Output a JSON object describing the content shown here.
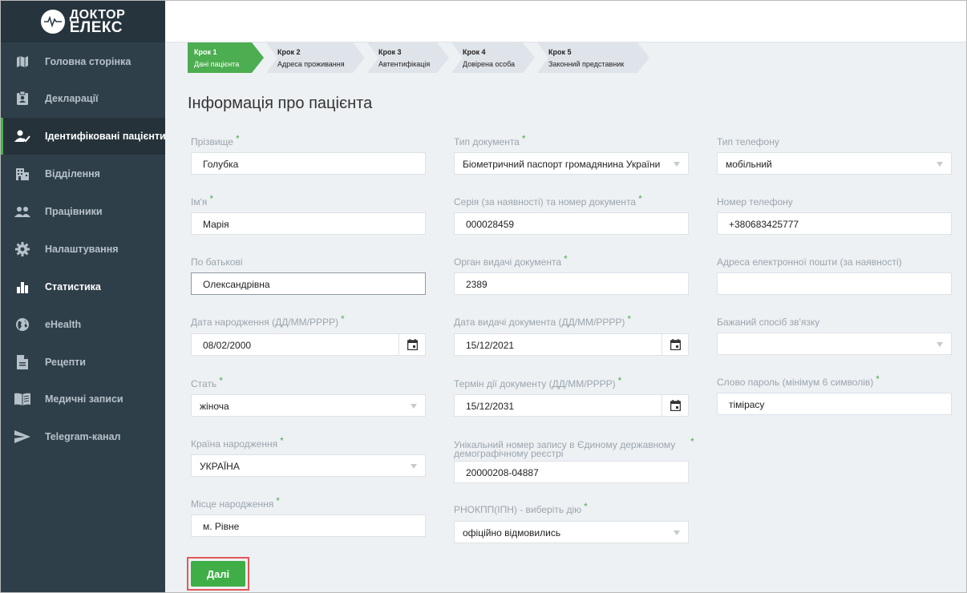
{
  "brand": {
    "line1": "ДОКТОР",
    "line2": "ЕЛЕКС"
  },
  "sidebar": {
    "items": [
      {
        "label": "Головна сторінка",
        "icon": "map-icon"
      },
      {
        "label": "Декларації",
        "icon": "badge-icon"
      },
      {
        "label": "Ідентифіковані пацієнти",
        "icon": "user-check-icon"
      },
      {
        "label": "Відділення",
        "icon": "building-icon"
      },
      {
        "label": "Працівники",
        "icon": "people-icon"
      },
      {
        "label": "Налаштування",
        "icon": "gear-icon"
      },
      {
        "label": "Статистика",
        "icon": "bar-chart-icon"
      },
      {
        "label": "eHealth",
        "icon": "globe-icon"
      },
      {
        "label": "Рецепти",
        "icon": "document-icon"
      },
      {
        "label": "Медичні записи",
        "icon": "book-icon"
      },
      {
        "label": "Telegram-канал",
        "icon": "send-icon"
      }
    ],
    "active_index": 2
  },
  "steps": [
    {
      "step": "Крок 1",
      "label": "Дані пацієнта"
    },
    {
      "step": "Крок 2",
      "label": "Адреса проживання"
    },
    {
      "step": "Крок 3",
      "label": "Автентифікація"
    },
    {
      "step": "Крок 4",
      "label": "Довірена особа"
    },
    {
      "step": "Крок 5",
      "label": "Законний представник"
    }
  ],
  "page_title": "Інформація про пацієнта",
  "required_mark": "*",
  "form": {
    "last_name": {
      "label": "Прізвище",
      "value": "Голубка"
    },
    "first_name": {
      "label": "Ім'я",
      "value": "Марія"
    },
    "patronymic": {
      "label": "По батькові",
      "value": "Олександрівна"
    },
    "birth_date": {
      "label": "Дата народження (ДД/ММ/РРРР)",
      "value": "08/02/2000"
    },
    "gender": {
      "label": "Стать",
      "value": "жіноча"
    },
    "birth_country": {
      "label": "Країна народження",
      "value": "УКРАЇНА"
    },
    "birth_place": {
      "label": "Місце народження",
      "value": "м. Рівне"
    },
    "doc_type": {
      "label": "Тип документа",
      "value": "Біометричний паспорт громадянина України"
    },
    "doc_number": {
      "label": "Серія (за наявності) та номер документа",
      "value": "000028459"
    },
    "doc_issuer": {
      "label": "Орган видачі документа",
      "value": "2389"
    },
    "doc_issue_date": {
      "label": "Дата видачі документа (ДД/ММ/РРРР)",
      "value": "15/12/2021"
    },
    "doc_expiry": {
      "label": "Термін дії документу (ДД/ММ/РРРР)",
      "value": "15/12/2031"
    },
    "unzr": {
      "label_line1": "Унікальний номер запису в Єдиному державному",
      "label_line2": "демографічному реєстрі",
      "value": "20000208-04887"
    },
    "rnokpp": {
      "label": "РНОКПП(ІПН) - виберіть дію",
      "value": "офіційно відмовились"
    },
    "phone_type": {
      "label": "Тип телефону",
      "value": "мобільний"
    },
    "phone": {
      "label": "Номер телефону",
      "value": "+380683425777"
    },
    "email": {
      "label": "Адреса електронної пошти (за наявності)",
      "value": ""
    },
    "contact_method": {
      "label": "Бажаний спосіб зв'язку",
      "value": ""
    },
    "password": {
      "label": "Слово пароль (мінімум 6 символів)",
      "value": "тімірасу"
    }
  },
  "next_button": "Далі",
  "colors": {
    "sidebar": "#2f3f4a",
    "accent": "#4cae50",
    "button": "#3fae47",
    "highlight": "#e25858"
  }
}
